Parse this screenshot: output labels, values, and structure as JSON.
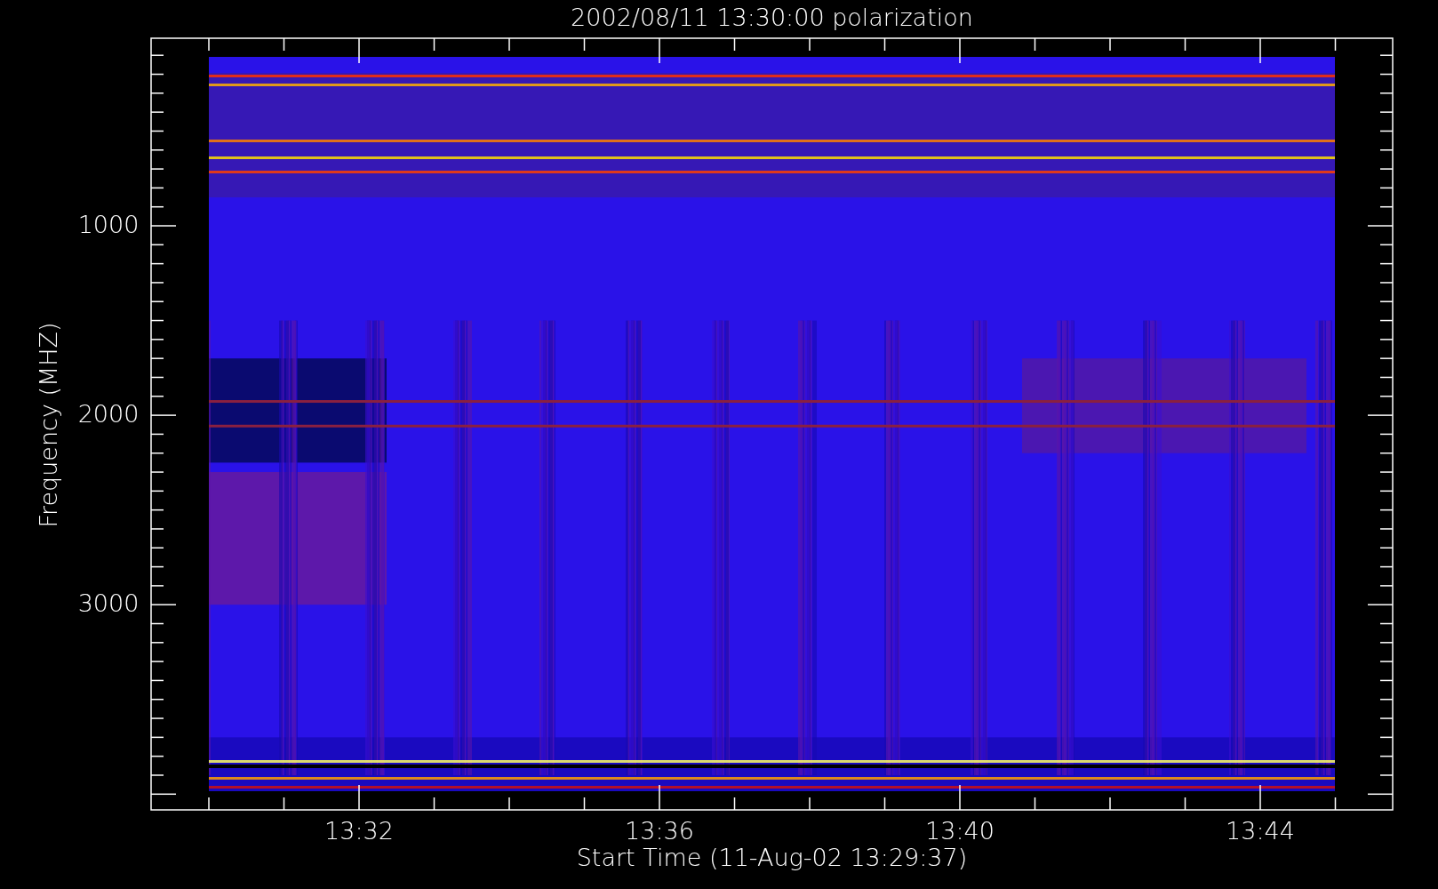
{
  "plot": {
    "title": "2002/08/11 13:30:00 polarization",
    "ylabel": "Frequency (MHZ)",
    "xlabel": "Start Time (11-Aug-02 13:29:37)",
    "y_tick_labels": [
      "1000",
      "2000",
      "3000"
    ],
    "x_tick_labels": [
      "13:32",
      "13:36",
      "13:40",
      "13:44"
    ]
  }
}
